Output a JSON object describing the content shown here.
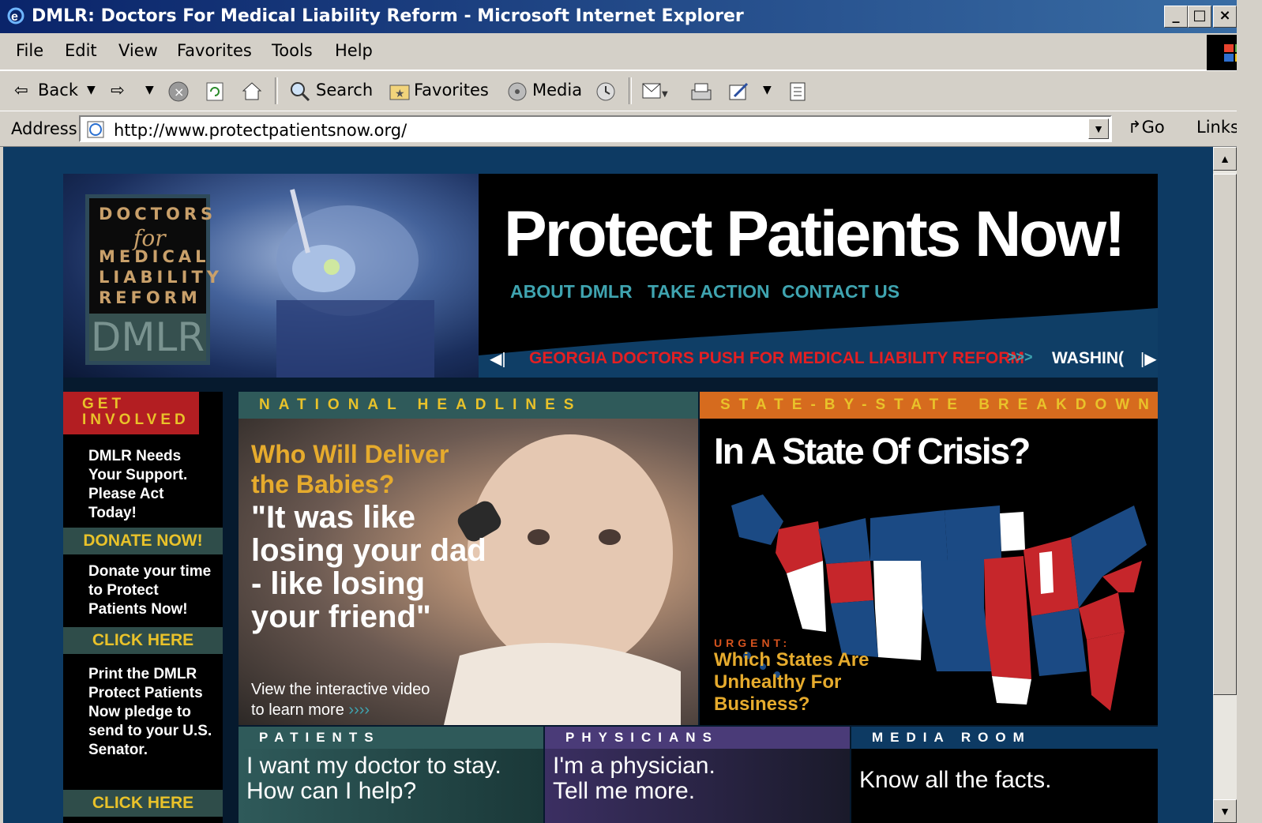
{
  "window": {
    "title": "DMLR: Doctors For Medical Liability Reform - Microsoft Internet Explorer",
    "minimize": "_",
    "maximize": "□",
    "close": "×"
  },
  "menu": [
    "File",
    "Edit",
    "View",
    "Favorites",
    "Tools",
    "Help"
  ],
  "toolbar": {
    "back": "Back",
    "search": "Search",
    "favorites": "Favorites",
    "media": "Media"
  },
  "address": {
    "label": "Address",
    "url": "http://www.protectpatientsnow.org/",
    "go": "Go",
    "links": "Links"
  },
  "logo": {
    "line1": "DOCTORS",
    "for": "for",
    "line2": "MEDICAL",
    "line3": "LIABILITY",
    "line4": "REFORM",
    "abbr": "DMLR"
  },
  "hero": {
    "title": "Protect Patients Now!",
    "nav": [
      "ABOUT DMLR",
      "TAKE ACTION",
      "CONTACT US"
    ],
    "ticker_headline": "GEORGIA DOCTORS PUSH FOR MEDICAL LIABILITY REFORM",
    "ticker_arrows": ">>>",
    "ticker_next_text": "WASHIN("
  },
  "left_column": {
    "heading": "GET INVOLVED",
    "support_text": "DMLR Needs Your Support. Please Act Today!",
    "donate_button": "DONATE NOW!",
    "donate_text": "Donate your time to Protect Patients Now!",
    "click_here_1": "CLICK HERE",
    "print_text": "Print the DMLR Protect Patients Now pledge to send to your U.S. Senator.",
    "click_here_2": "CLICK HERE"
  },
  "national": {
    "heading": "NATIONAL HEADLINES",
    "question": "Who Will Deliver the Babies?",
    "quote": "\"It was like losing your dad - like losing your friend\"",
    "view_text": "View the interactive video to learn more"
  },
  "state": {
    "heading": "STATE-BY-STATE BREAKDOWN",
    "title": "In A State Of Crisis?",
    "urgent": "URGENT:",
    "which": "Which States Are Unhealthy For Business?"
  },
  "bottom": {
    "patients_heading": "PATIENTS",
    "patients_text_1": "I want my doctor to stay.",
    "patients_text_2": "How can I help?",
    "physicians_heading": "PHYSICIANS",
    "physicians_text_1": "I'm a physician.",
    "physicians_text_2": "Tell me more.",
    "media_heading": "MEDIA ROOM",
    "media_text": "Know all the facts."
  },
  "colors": {
    "page_background": "#0d3a63",
    "title_bar": "#0a246a",
    "accent_teal": "#3fa4b0",
    "accent_gold": "#e9c22a",
    "accent_red": "#b31e22",
    "accent_orange": "#d66b1e",
    "ticker_red": "#e41f22"
  }
}
